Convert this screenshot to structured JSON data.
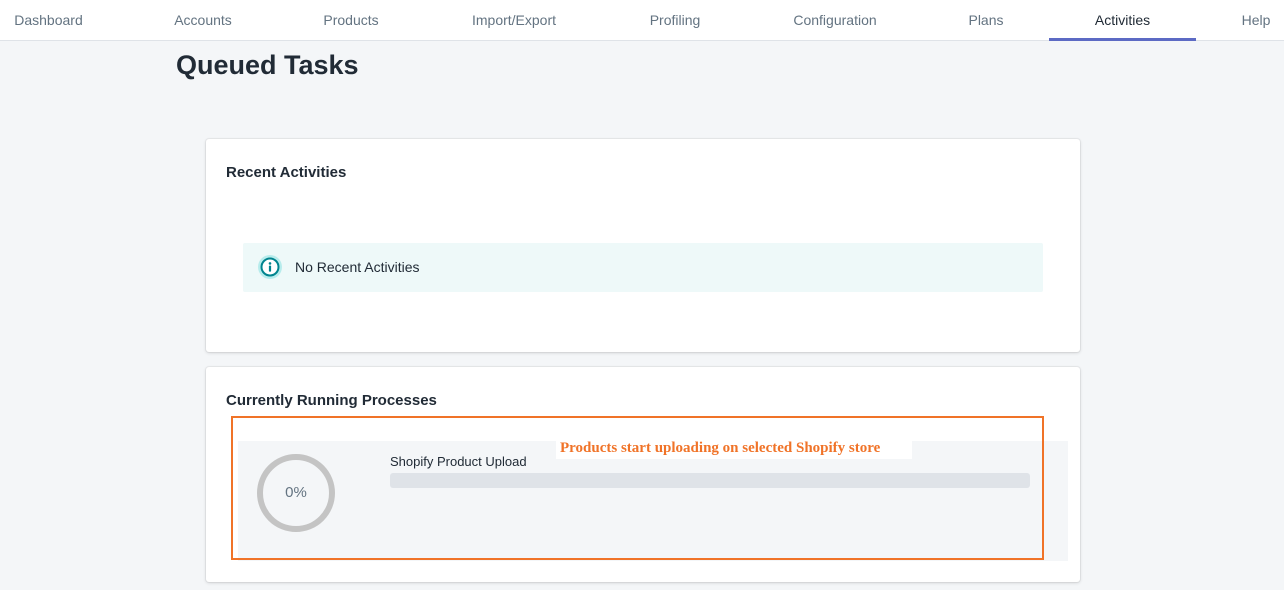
{
  "nav": {
    "items": [
      {
        "label": "Dashboard"
      },
      {
        "label": "Accounts"
      },
      {
        "label": "Products"
      },
      {
        "label": "Import/Export"
      },
      {
        "label": "Profiling"
      },
      {
        "label": "Configuration"
      },
      {
        "label": "Plans"
      },
      {
        "label": "Activities",
        "active": true
      },
      {
        "label": "Help"
      }
    ],
    "accent_color": "#5c6ac4"
  },
  "page": {
    "title": "Queued Tasks"
  },
  "recent_activities": {
    "title": "Recent Activities",
    "banner": {
      "icon": "info-icon",
      "text": "No Recent Activities"
    }
  },
  "running_processes": {
    "title": "Currently Running Processes",
    "processes": [
      {
        "name": "Shopify Product Upload",
        "progress_percent": 0,
        "progress_label": "0%"
      }
    ]
  },
  "annotation": {
    "text": "Products start uploading on selected Shopify store",
    "color": "#f07328"
  }
}
